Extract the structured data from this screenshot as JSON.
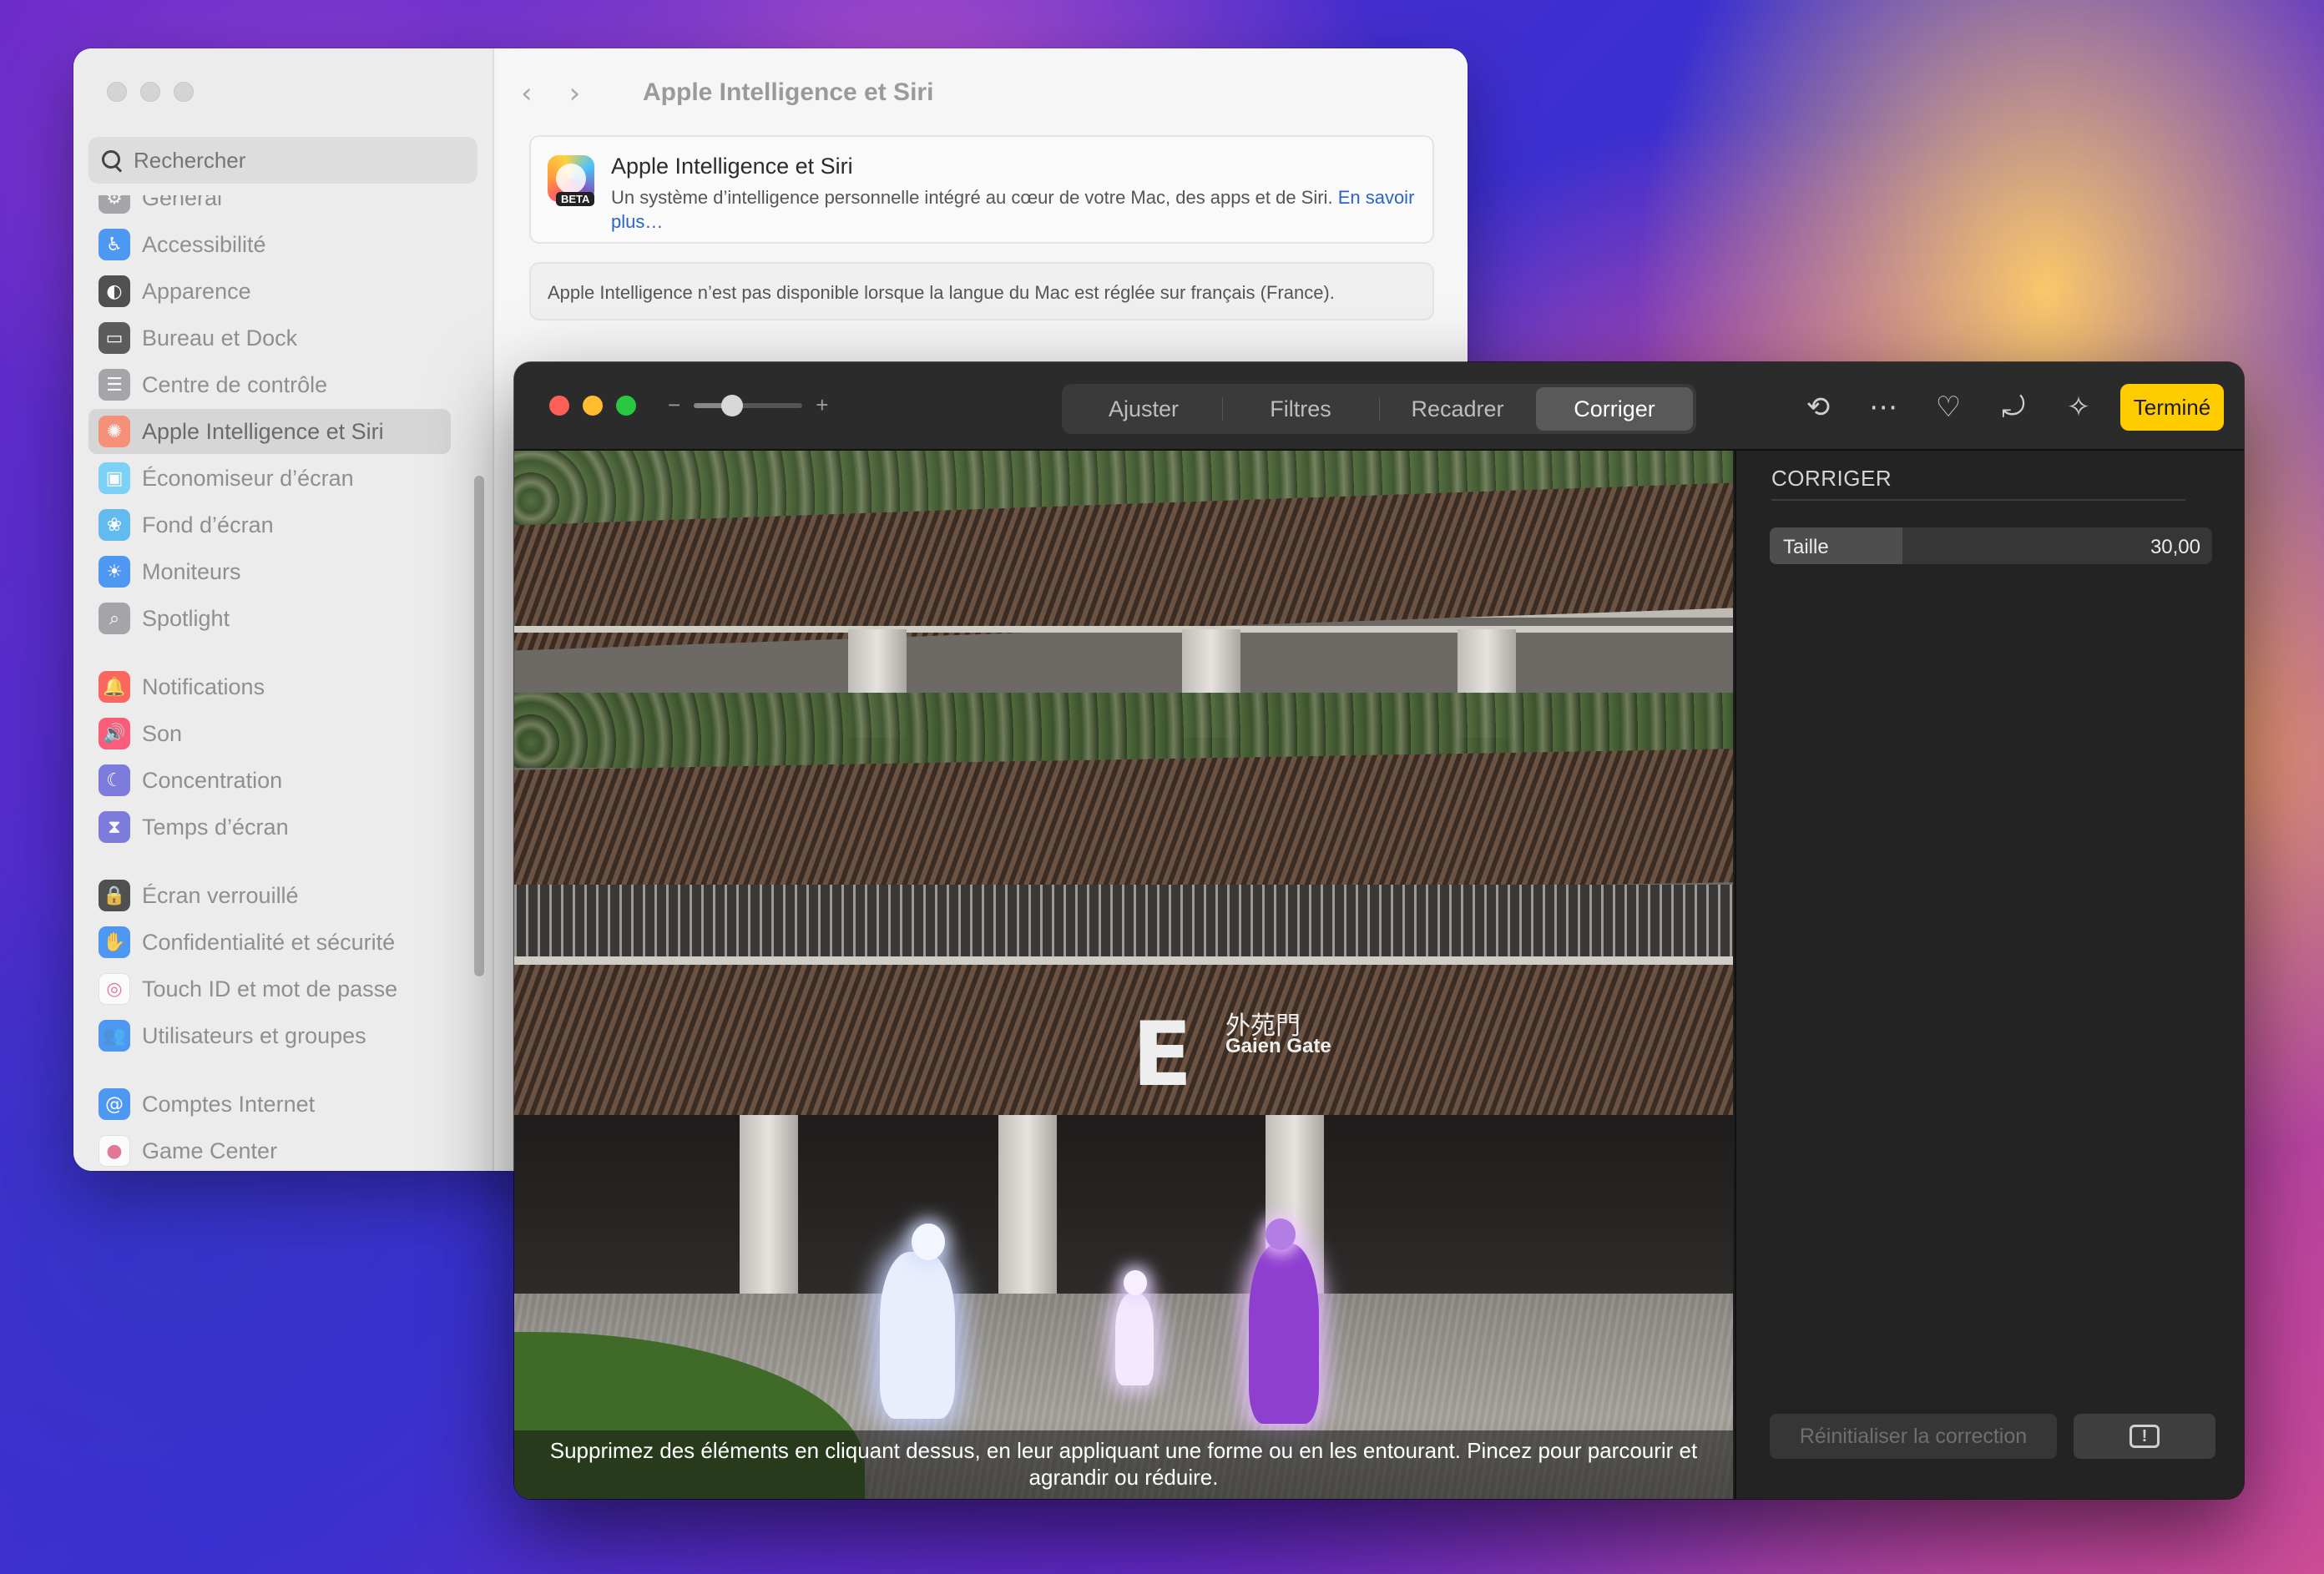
{
  "settings": {
    "search_placeholder": "Rechercher",
    "title": "Apple Intelligence et Siri",
    "nav_back": "‹",
    "nav_forward": "›",
    "sidebar": [
      {
        "label": "Général",
        "icon": "gear-icon",
        "color": "#8e8e93",
        "glyph": "⚙"
      },
      {
        "label": "Accessibilité",
        "icon": "accessibility-icon",
        "color": "#1a7cf5",
        "glyph": "♿"
      },
      {
        "label": "Apparence",
        "icon": "appearance-icon",
        "color": "#1c1c1e",
        "glyph": "◐"
      },
      {
        "label": "Bureau et Dock",
        "icon": "dock-icon",
        "color": "#2c2c2e",
        "glyph": "▭"
      },
      {
        "label": "Centre de contrôle",
        "icon": "control-center-icon",
        "color": "#8e8e93",
        "glyph": "☰"
      },
      {
        "label": "Apple Intelligence et Siri",
        "icon": "apple-intelligence-icon",
        "color": "#ff7a59",
        "glyph": "✺",
        "selected": true
      },
      {
        "label": "Économiseur d’écran",
        "icon": "screensaver-icon",
        "color": "#5ac8fa",
        "glyph": "▣"
      },
      {
        "label": "Fond d’écran",
        "icon": "wallpaper-icon",
        "color": "#35aaf0",
        "glyph": "❀"
      },
      {
        "label": "Moniteurs",
        "icon": "displays-icon",
        "color": "#1a7cf5",
        "glyph": "☀"
      },
      {
        "label": "Spotlight",
        "icon": "spotlight-icon",
        "color": "#8e8e93",
        "glyph": "⌕"
      },
      {
        "label": "Notifications",
        "icon": "notifications-icon",
        "color": "#ff3b30",
        "glyph": "🔔"
      },
      {
        "label": "Son",
        "icon": "sound-icon",
        "color": "#ff2d55",
        "glyph": "🔊"
      },
      {
        "label": "Concentration",
        "icon": "focus-icon",
        "color": "#5856d6",
        "glyph": "☾"
      },
      {
        "label": "Temps d’écran",
        "icon": "screen-time-icon",
        "color": "#5856d6",
        "glyph": "⧗"
      },
      {
        "label": "Écran verrouillé",
        "icon": "lock-screen-icon",
        "color": "#1c1c1e",
        "glyph": "🔒"
      },
      {
        "label": "Confidentialité et sécurité",
        "icon": "privacy-hand-icon",
        "color": "#1a7cf5",
        "glyph": "✋"
      },
      {
        "label": "Touch ID et mot de passe",
        "icon": "fingerprint-icon",
        "color": "#ffffff",
        "glyph": "◎"
      },
      {
        "label": "Utilisateurs et groupes",
        "icon": "users-icon",
        "color": "#1a7cf5",
        "glyph": "👥"
      },
      {
        "label": "Comptes Internet",
        "icon": "at-icon",
        "color": "#1a7cf5",
        "glyph": "@"
      },
      {
        "label": "Game Center",
        "icon": "game-center-icon",
        "color": "#ffffff",
        "glyph": "●"
      }
    ],
    "card": {
      "heading": "Apple Intelligence et Siri",
      "badge": "BETA",
      "description": "Un système d’intelligence personnelle intégré au cœur de votre Mac, des apps et de Siri.",
      "link": "En savoir plus…"
    },
    "notice": "Apple Intelligence n’est pas disponible lorsque la langue du Mac est réglée sur français (France)."
  },
  "photos": {
    "zoom_minus": "−",
    "zoom_plus": "+",
    "zoom_level": 0.35,
    "tabs": [
      "Ajuster",
      "Filtres",
      "Recadrer",
      "Corriger"
    ],
    "active_tab": "Corriger",
    "tools": [
      {
        "name": "clean-up-history-icon",
        "glyph": "⟲"
      },
      {
        "name": "more-options-icon",
        "glyph": "⋯"
      },
      {
        "name": "favorite-heart-icon",
        "glyph": "♡"
      },
      {
        "name": "rotate-icon",
        "glyph": "⤾"
      },
      {
        "name": "auto-enhance-wand-icon",
        "glyph": "✧"
      }
    ],
    "done": "Terminé",
    "sign_letter": "E",
    "sign_japanese": "外苑門",
    "sign_english": "Gaien Gate",
    "caption": "Supprimez des éléments en cliquant dessus, en leur appliquant une forme ou en les entourant. Pincez pour parcourir et agrandir ou réduire.",
    "panel": {
      "title": "CORRIGER",
      "slider_label": "Taille",
      "slider_value": "30,00",
      "slider_fraction": 0.3,
      "reset": "Réinitialiser la correction",
      "feedback_glyph": "!"
    }
  },
  "colors": {
    "accent_done": "#ffcc00",
    "link": "#2a64c8"
  }
}
